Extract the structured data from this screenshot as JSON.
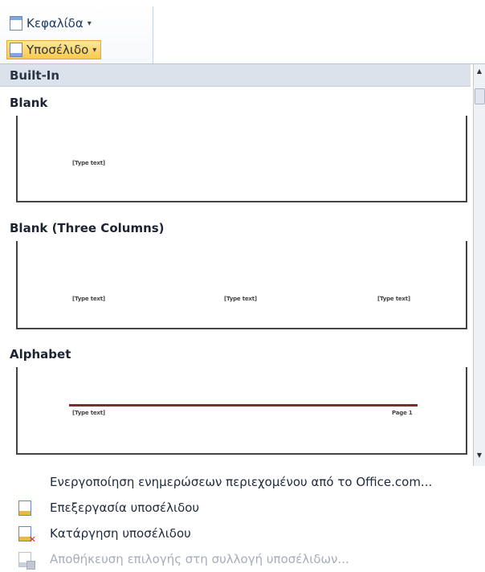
{
  "ribbon": {
    "header_button": {
      "label": "Κεφαλίδα",
      "icon": "header-icon"
    },
    "footer_button": {
      "label": "Υποσέλιδο",
      "icon": "footer-icon",
      "state": "active"
    }
  },
  "gallery": {
    "heading": "Built-In",
    "sections": [
      {
        "title": "Blank",
        "texts": [
          "[Type text]"
        ]
      },
      {
        "title": "Blank (Three Columns)",
        "texts": [
          "[Type text]",
          "[Type text]",
          "[Type text]"
        ]
      },
      {
        "title": "Alphabet",
        "texts": [
          "[Type text]",
          "Page 1"
        ],
        "rule_color": "#7d2e2a"
      }
    ]
  },
  "menu": {
    "items": [
      {
        "label": "Ενεργοποίηση ενημερώσεων περιεχομένου από το Office.com...",
        "icon": "",
        "enabled": true
      },
      {
        "label": "Επεξεργασία υποσέλιδου",
        "icon": "edit-footer-icon",
        "enabled": true
      },
      {
        "label": "Κατάργηση υποσέλιδου",
        "icon": "remove-footer-icon",
        "enabled": true
      },
      {
        "label": "Αποθήκευση επιλογής στη συλλογή υποσέλιδων...",
        "icon": "save-selection-icon",
        "enabled": false
      }
    ]
  },
  "colors": {
    "accent": "#f9c94f",
    "gallery_header": "#dbe2ec",
    "alphabet_rule": "#7d2e2a"
  }
}
